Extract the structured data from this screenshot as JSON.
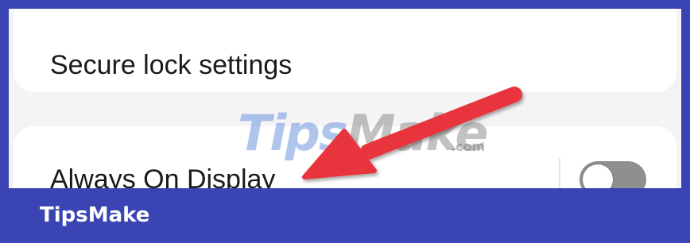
{
  "settings": {
    "secure_lock_label": "Secure lock settings",
    "always_on_display_label": "Always On Display",
    "always_on_display_enabled": false
  },
  "watermark": {
    "part1": "Tips",
    "part2": "Make",
    "suffix": ".com"
  },
  "banner": {
    "text": "TipsMake"
  },
  "colors": {
    "frame_blue": "#3a44b3",
    "arrow_red": "#e8343c",
    "toggle_off": "#8f8f8f"
  },
  "icons": {
    "annotation": "arrow-icon"
  }
}
